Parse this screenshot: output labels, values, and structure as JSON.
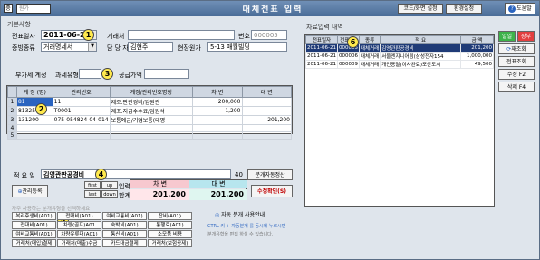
{
  "titlebar": {
    "sys_icon": "중",
    "combo": "원가",
    "title": "대체전표 입력",
    "btn_code": "코드/화면 설정",
    "btn_setting": "환경설정",
    "btn_help": "도움말"
  },
  "basic": {
    "group_title": "기본사항",
    "date_label": "전표일자",
    "date_value": "2011-06-21",
    "vendor_label": "거래처",
    "vendor_value": "",
    "number_label": "번호",
    "number_value": "000005",
    "type_label": "증빙종류",
    "type_value": "거래명세서",
    "manager_label": "담 당 자",
    "manager_value": "김현주",
    "site_label": "현장원가",
    "site_value": "5-13 매월빌딩"
  },
  "tax": {
    "vat_label": "부가세 계정",
    "taxtype_label": "과세유형",
    "supply_label": "공급가액",
    "supply_value": ""
  },
  "grid": {
    "headers": [
      "계 정 (명)",
      "관리번호",
      "계정/관리번호명칭",
      "차  변",
      "대  변"
    ],
    "rows": [
      {
        "rn": "1",
        "acct": "81",
        "mgmt": "11",
        "name": "제조.판관경비/임원관",
        "debit": "200,000",
        "credit": ""
      },
      {
        "rn": "2",
        "acct": "81325",
        "mgmt": "T0001",
        "name": "제조.지급수수료/임원석",
        "debit": "1,200",
        "credit": ""
      },
      {
        "rn": "3",
        "acct": "131200",
        "mgmt": "075-054824-04-014",
        "name": "보통예금/기업보통(대명",
        "debit": "",
        "credit": "201,200"
      },
      {
        "rn": "4",
        "acct": "",
        "mgmt": "",
        "name": "",
        "debit": "",
        "credit": ""
      },
      {
        "rn": "5",
        "acct": "",
        "mgmt": "",
        "name": "",
        "debit": "",
        "credit": ""
      }
    ]
  },
  "memo": {
    "label": "적 요 일",
    "value": "김영관판공경비",
    "count": "40",
    "btn_auto": "분개자동정산"
  },
  "actions": {
    "btn_mgmt": "관리등록",
    "nav_first": "first",
    "nav_up": "up",
    "nav_last": "last",
    "nav_down": "down",
    "sum_label_top": "입력",
    "sum_label_bottom": "합계",
    "debit_header": "차  변",
    "credit_header": "대  변",
    "debit_total": "201,200",
    "credit_total": "201,200",
    "btn_edit": "수정확인(S)"
  },
  "quick": {
    "caption": "자주 사용하는 분개유형을 선택하세요",
    "buttons": [
      [
        "복리후생비(A01)",
        "접대비(A01)",
        "여비교통비(A01)",
        "잡비(A01)"
      ],
      [
        "접대비(A01)",
        "차량(골프)A01",
        "숙박비(A01)",
        "통행료(A01)"
      ],
      [
        "여비교통비(A01)",
        "차량유류대(A01)",
        "통신비(A01)",
        "소모품 비용"
      ],
      [
        "거래처(매입)결제",
        "거래처(매출)수금",
        "카드대금결제",
        "거래처(보험공제)"
      ]
    ],
    "info_title": "자동 분개 사용안내",
    "info_line1": "CTRL 키 + 자동분개 를 동시에 누르시면",
    "info_line2": "분개유형을 편집 하실 수 있습니다."
  },
  "history": {
    "title": "자료입력 내역",
    "headers": [
      "전표일자",
      "전표NO",
      "종류",
      "적  요",
      "금  액"
    ],
    "rows": [
      {
        "date": "2011-06-21",
        "no": "000005",
        "kind": "대체거래",
        "memo": "김영관판공경비",
        "amount": "201,200",
        "selected": true
      },
      {
        "date": "2011-06-21",
        "no": "000006",
        "kind": "대체거래",
        "memo": "서울엔지니어링(삼성전자154",
        "amount": "1,000,000",
        "selected": false
      },
      {
        "date": "2011-06-21",
        "no": "000009",
        "kind": "대체거래",
        "memo": "개인용달(이사완료)포산도시",
        "amount": "49,500",
        "selected": false
      }
    ]
  },
  "side": {
    "btn_add": "일일",
    "btn_add2": "장부",
    "btn_query": "재조회",
    "btn_print": "전표조회",
    "btn_modify": "수정 F2",
    "btn_delete": "삭제 F4"
  },
  "markers": [
    "1",
    "2",
    "3",
    "4",
    "5",
    "6"
  ]
}
